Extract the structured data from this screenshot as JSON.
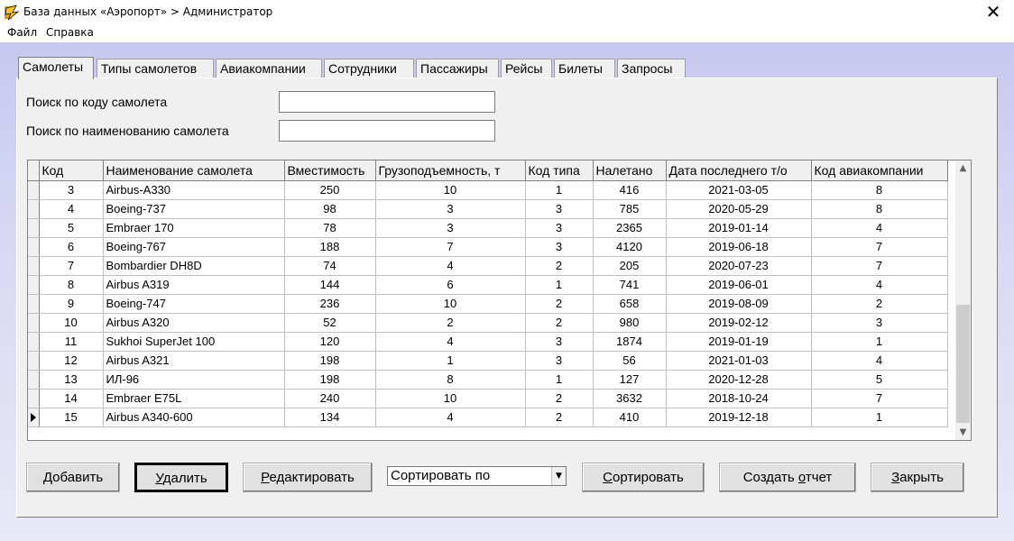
{
  "window": {
    "title": "База данных «Аэропорт» > Администратор",
    "close_glyph": "✕"
  },
  "menu": [
    "Файл",
    "Справка"
  ],
  "tabs": [
    "Самолеты",
    "Типы самолетов",
    "Авиакомпании",
    "Сотрудники",
    "Пассажиры",
    "Рейсы",
    "Билеты",
    "Запросы"
  ],
  "active_tab": 0,
  "search": {
    "code_label": "Поиск по коду самолета",
    "code_value": "",
    "name_label": "Поиск по наименованию самолета",
    "name_value": ""
  },
  "grid": {
    "columns": [
      "Код",
      "Наименование самолета",
      "Вместимость",
      "Грузоподъемность, т",
      "Код типа",
      "Налетано",
      "Дата последнего т/о",
      "Код авиакомпании"
    ],
    "rows": [
      [
        "3",
        "Airbus-A330",
        "250",
        "10",
        "1",
        "416",
        "2021-03-05",
        "8"
      ],
      [
        "4",
        "Boeing-737",
        "98",
        "3",
        "3",
        "785",
        "2020-05-29",
        "8"
      ],
      [
        "5",
        "Embraer 170",
        "78",
        "3",
        "3",
        "2365",
        "2019-01-14",
        "4"
      ],
      [
        "6",
        "Boeing-767",
        "188",
        "7",
        "3",
        "4120",
        "2019-06-18",
        "7"
      ],
      [
        "7",
        "Bombardier DH8D",
        "74",
        "4",
        "2",
        "205",
        "2020-07-23",
        "7"
      ],
      [
        "8",
        "Airbus A319",
        "144",
        "6",
        "1",
        "741",
        "2019-06-01",
        "4"
      ],
      [
        "9",
        "Boeing-747",
        "236",
        "10",
        "2",
        "658",
        "2019-08-09",
        "2"
      ],
      [
        "10",
        "Airbus A320",
        "52",
        "2",
        "2",
        "980",
        "2019-02-12",
        "3"
      ],
      [
        "11",
        "Sukhoi SuperJet 100",
        "120",
        "4",
        "3",
        "1874",
        "2019-01-19",
        "1"
      ],
      [
        "12",
        "Airbus A321",
        "198",
        "1",
        "3",
        "56",
        "2021-01-03",
        "4"
      ],
      [
        "13",
        "ИЛ-96",
        "198",
        "8",
        "1",
        "127",
        "2020-12-28",
        "5"
      ],
      [
        "14",
        "Embraer E75L",
        "240",
        "10",
        "2",
        "3632",
        "2018-10-24",
        "7"
      ],
      [
        "15",
        "Airbus A340-600",
        "134",
        "4",
        "2",
        "410",
        "2019-12-18",
        "1"
      ]
    ],
    "current_row": 12
  },
  "buttons": {
    "add": {
      "pre": "",
      "u": "Д",
      "post": "обавить"
    },
    "delete": {
      "pre": "",
      "u": "У",
      "post": "далить"
    },
    "edit": {
      "pre": "",
      "u": "Р",
      "post": "едактировать"
    },
    "sort": {
      "pre": "",
      "u": "С",
      "post": "ортировать"
    },
    "report": {
      "pre": "Создать ",
      "u": "о",
      "post": "тчет"
    },
    "close": {
      "pre": "",
      "u": "З",
      "post": "акрыть"
    }
  },
  "sort_combo": {
    "value": "Сортировать по"
  }
}
